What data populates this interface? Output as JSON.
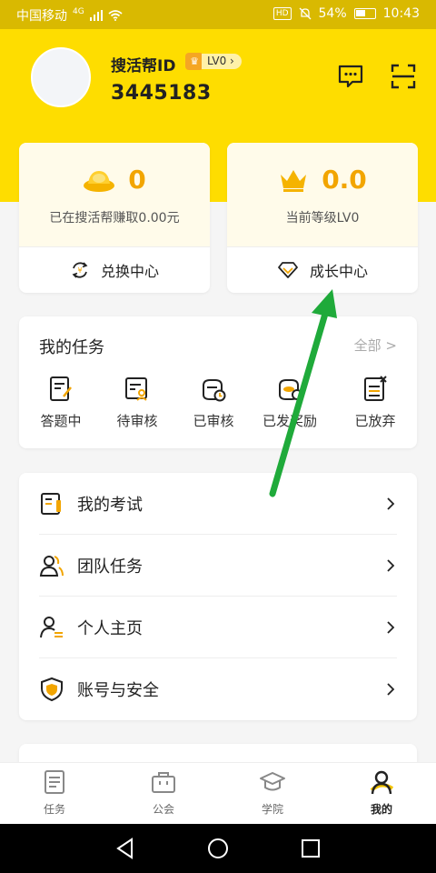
{
  "status_bar": {
    "carrier": "中国移动",
    "network": "4G",
    "hd": "HD",
    "battery": "54%",
    "time": "10:43"
  },
  "profile": {
    "name": "搜活帮ID",
    "level": "LV0",
    "id": "3445183"
  },
  "stats": {
    "earn": {
      "value": "0",
      "caption": "已在搜活帮赚取0.00元",
      "link": "兑换中心"
    },
    "level": {
      "value": "0.0",
      "caption": "当前等级LV0",
      "link": "成长中心"
    }
  },
  "tasks": {
    "title": "我的任务",
    "all_label": "全部 >",
    "items": [
      {
        "label": "答题中",
        "icon": "answering-icon"
      },
      {
        "label": "待审核",
        "icon": "pending-review-icon"
      },
      {
        "label": "已审核",
        "icon": "reviewed-icon"
      },
      {
        "label": "已发奖励",
        "icon": "rewarded-icon"
      },
      {
        "label": "已放弃",
        "icon": "abandoned-icon"
      }
    ]
  },
  "menu": [
    {
      "label": "我的考试",
      "icon": "exam-icon"
    },
    {
      "label": "团队任务",
      "icon": "team-icon"
    },
    {
      "label": "个人主页",
      "icon": "profile-icon"
    },
    {
      "label": "账号与安全",
      "icon": "shield-icon"
    }
  ],
  "tabs": [
    {
      "label": "任务",
      "icon": "task-icon"
    },
    {
      "label": "公会",
      "icon": "guild-icon"
    },
    {
      "label": "学院",
      "icon": "academy-icon"
    },
    {
      "label": "我的",
      "icon": "me-icon",
      "active": true
    }
  ],
  "colors": {
    "brand_yellow": "#fedd00",
    "accent_orange": "#f2a500",
    "annotation_green": "#1faa3a"
  }
}
